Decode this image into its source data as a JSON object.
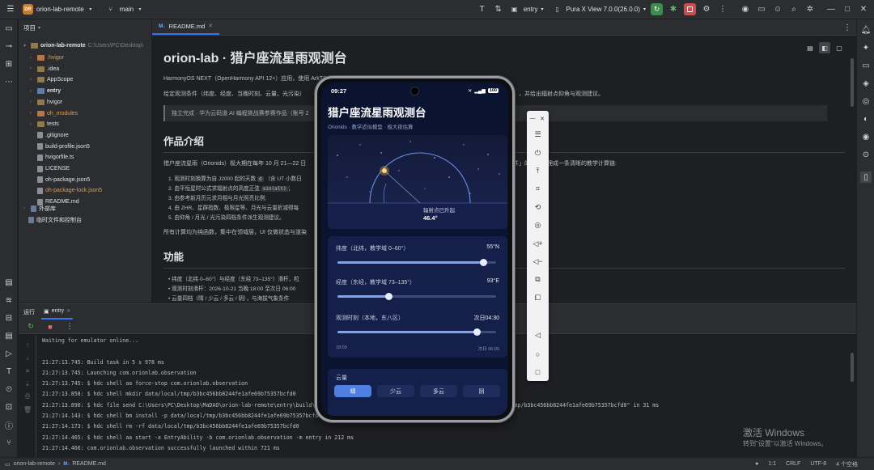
{
  "titlebar": {
    "project_badge": "DR",
    "project_name": "orion-lab-remote",
    "branch": "main",
    "run_config": "entry",
    "device": "Pura X View 7.0.0(26.0.0)"
  },
  "project_panel": {
    "title": "项目",
    "root": "orion-lab-remote",
    "root_path": "C:\\Users\\PC\\Desktop\\",
    "items": [
      {
        "label": ".hvigor",
        "type": "folder-orange"
      },
      {
        "label": ".idea",
        "type": "folder"
      },
      {
        "label": "AppScope",
        "type": "folder"
      },
      {
        "label": "entry",
        "type": "folder-blue"
      },
      {
        "label": "hvigor",
        "type": "folder"
      },
      {
        "label": "oh_modules",
        "type": "folder-orange"
      },
      {
        "label": "tests",
        "type": "folder"
      },
      {
        "label": ".gitignore",
        "type": "file"
      },
      {
        "label": "build-profile.json5",
        "type": "file"
      },
      {
        "label": "hvigorfile.ts",
        "type": "file"
      },
      {
        "label": "LICENSE",
        "type": "file"
      },
      {
        "label": "oh-package.json5",
        "type": "file"
      },
      {
        "label": "oh-package-lock.json5",
        "type": "file-orange"
      },
      {
        "label": "README.md",
        "type": "file"
      }
    ],
    "external": "外部库",
    "scratch": "临时文件和控制台"
  },
  "editor": {
    "tab": "README.md",
    "h1": "orion-lab · 猎户座流星雨观测台",
    "p1": "HarmonyOS NEXT（OpenHarmony API 12+）应用，使用 ArkTS + ArkUI 声明式开发。",
    "p2": "给定观测条件（纬度、经度、当晚时刻、云量、光污染）",
    "p2b": "，并给出辐射点仰角与观测建议。",
    "quote": "独立完成 · 华为云码道 AI 编程挑战赛参赛作品（账号 2",
    "h2_intro": "作品介绍",
    "intro": "猎户座流星雨（Orionids）极大期在每年 10 月 21—22 日",
    "intro_b": "件」的估算整理成一条清晰的教学计算链:",
    "steps": [
      "1. 观测时刻换算为自 J2000 起的天数",
      "2. 由平恒星时公式求辐射点的高度正弦",
      "3. 由参考新月历元求月相与月光照亮比例;",
      "4. 由 ZHR、星群指数、极限星等、月光与云量折减得每",
      "5. 由仰角 / 月光 / 光污染四档条件派生观测建议。"
    ],
    "step1_code": "d",
    "step1_tail": "（含 UT 小数日",
    "step2_code": "sin(alt)",
    "note": "所有计算均为纯函数，集中在领域层，UI 仅做状态与渲染",
    "h2_features": "功能",
    "features": [
      "纬度（北纬 0–60°）与经度（东经 73–135°）滑杆，粒",
      "观测时刻滑杆：2026-10-21 当晚 18:00 至次日 06:00",
      "云量四档（晴 / 少云 / 多云 / 阴），与海拔气象条件"
    ]
  },
  "run_panel": {
    "tab_run": "运行",
    "tab_entry": "entry",
    "console": [
      "Waiting for emulator online...",
      "",
      "21:27:13.745: Build task in 5 s 978 ms",
      "21:27:13.745: Launching com.orionlab.observation",
      "21:27:13.745: $ hdc shell aa force-stop com.orionlab.observation",
      "21:27:13.858: $ hdc shell mkdir data/local/tmp/b3bc456bb8244fe1afe69b75357bcfd0",
      "21:27:13.890: $ hdc file send C:\\Users\\PC\\Desktop\\MaDAO\\orion-lab-remote\\entry\\build\\default\\outputs\\default\\entry-default-signed.hap \"data/local/tmp/b3bc456bb8244fe1afe69b75357bcfd0\" in 31 ms",
      "21:27:14.143: $ hdc shell bm install -p data/local/tmp/b3bc456bb8244fe1afe69b75357bcfd0",
      "21:27:14.173: $ hdc shell rm -rf data/local/tmp/b3bc456bb8244fe1afe69b75357bcfd0",
      "21:27:14.465: $ hdc shell aa start -a EntryAbility -b com.orionlab.observation -m entry in 212 ms",
      "21:27:14.466: com.orionlab.observation successfully launched within 721 ms"
    ]
  },
  "statusbar": {
    "path_root": "orion-lab-remote",
    "path_file": "README.md",
    "position": "1:1",
    "line_sep": "CRLF",
    "encoding": "UTF-8",
    "indent": "4 个空格"
  },
  "phone": {
    "time": "09:27",
    "battery": "100",
    "title": "猎户座流星雨观测台",
    "subtitle": "Orionids · 教学近似模型 · 极大夜估算",
    "radiant_label": "辐射点已升起",
    "radiant_value": "46.4°",
    "lat_label": "纬度（北纬，教学域 0–60°）",
    "lat_value": "55°N",
    "lat_fraction": 0.917,
    "lon_label": "经度（东经，教学域 73–135°）",
    "lon_value": "93°E",
    "lon_fraction": 0.32,
    "time_label": "观测时刻（本地，东八区）",
    "time_value": "次日04:30",
    "time_fraction": 0.875,
    "time_min": "18:00",
    "time_max": "次日 06:00",
    "cloud_label": "云量",
    "cloud_options": [
      "晴",
      "少云",
      "多云",
      "阴"
    ],
    "cloud_selected": "晴"
  },
  "watermark": {
    "line1": "激活 Windows",
    "line2": "转到\"设置\"以激活 Windows。"
  }
}
